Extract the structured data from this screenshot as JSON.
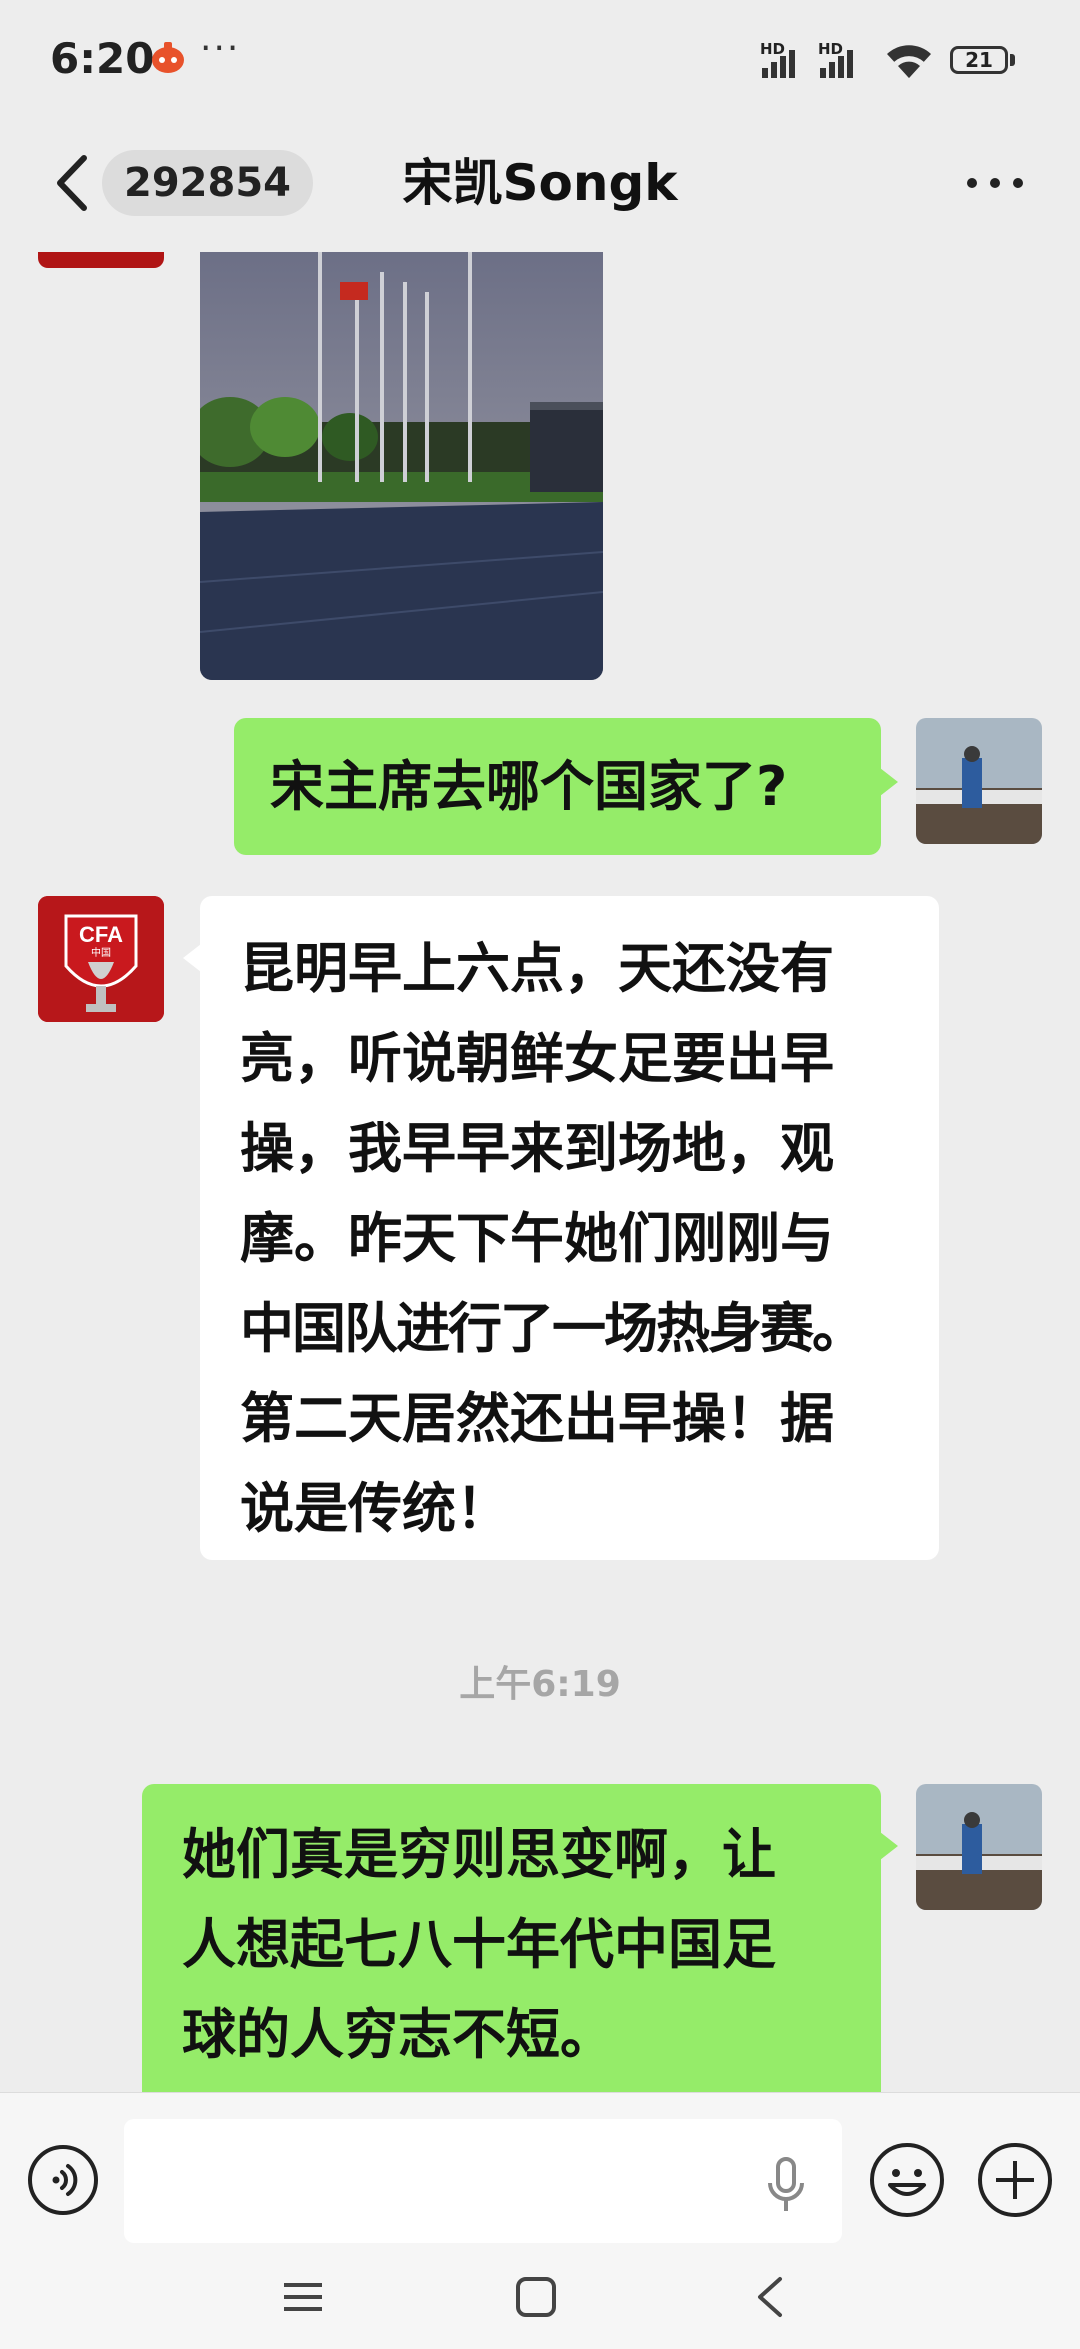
{
  "status_bar": {
    "time": "6:20",
    "more": "···",
    "hd_label": "HD",
    "battery": "21"
  },
  "header": {
    "unread_count": "292854",
    "title": "宋凯Songk"
  },
  "messages": [
    {
      "type": "image",
      "side": "left",
      "description_icon": "photo-stadium-flagpoles"
    },
    {
      "type": "text",
      "side": "right",
      "text": "宋主席去哪个国家了?"
    },
    {
      "type": "text",
      "side": "left",
      "lines": [
        "昆明早上六点，天还没有",
        "亮，听说朝鲜女足要出早",
        "操，我早早来到场地，观",
        "摩。昨天下午她们刚刚与",
        "中国队进行了一场热身赛。",
        "第二天居然还出早操！据",
        "说是传统！"
      ]
    },
    {
      "type": "timestamp",
      "text": "上午6:19"
    },
    {
      "type": "text",
      "side": "right",
      "lines": [
        "她们真是穷则思变啊，让",
        "人想起七八十年代中国足",
        "球的人穷志不短。"
      ]
    }
  ],
  "avatars": {
    "left_logo_text": "CFA",
    "left_logo_sub": "中国"
  },
  "input": {
    "placeholder": ""
  },
  "colors": {
    "background": "#ededed",
    "bubble_green": "#95ec69",
    "bubble_white": "#ffffff",
    "timestamp": "#a6a6a6"
  },
  "icons": [
    "back-arrow-icon",
    "more-dots-icon",
    "voice-icon",
    "mic-icon",
    "emoji-icon",
    "plus-icon",
    "menu-icon",
    "home-icon",
    "back-nav-icon"
  ]
}
